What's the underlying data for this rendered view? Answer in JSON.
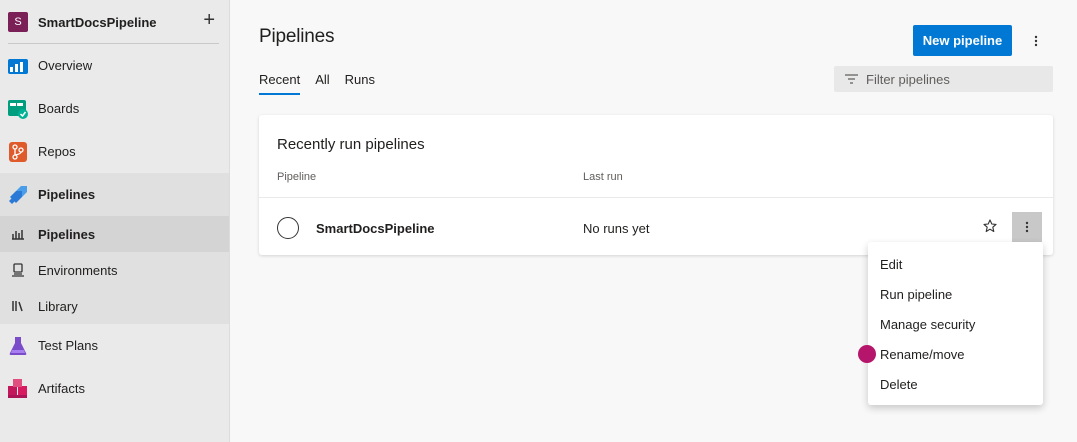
{
  "project": {
    "avatar_letter": "S",
    "name": "SmartDocsPipeline",
    "add_label": "+"
  },
  "nav": {
    "overview": "Overview",
    "boards": "Boards",
    "repos": "Repos",
    "pipelines_group": "Pipelines",
    "pipelines_sub": "Pipelines",
    "environments": "Environments",
    "library": "Library",
    "test_plans": "Test Plans",
    "artifacts": "Artifacts"
  },
  "page": {
    "title": "Pipelines",
    "new_pipeline_label": "New pipeline",
    "tabs": [
      "Recent",
      "All",
      "Runs"
    ],
    "filter_placeholder": "Filter pipelines"
  },
  "card": {
    "title": "Recently run pipelines",
    "columns": [
      "Pipeline",
      "Last run"
    ],
    "rows": [
      {
        "name": "SmartDocsPipeline",
        "last_run": "No runs yet"
      }
    ]
  },
  "context_menu": {
    "items": [
      "Edit",
      "Run pipeline",
      "Manage security",
      "Rename/move",
      "Delete"
    ]
  },
  "colors": {
    "accent": "#0078d4",
    "project_avatar": "#7b1f57",
    "cursor_marker": "#b5166b"
  },
  "icons": {
    "overview": "overview-icon",
    "boards": "boards-icon",
    "repos": "repos-icon",
    "pipelines": "pipelines-icon",
    "environments": "environments-icon",
    "library": "library-icon",
    "test_plans": "test-plans-icon",
    "artifacts": "artifacts-icon",
    "filter": "filter-icon",
    "star": "star-icon",
    "more": "more-vertical-icon"
  }
}
